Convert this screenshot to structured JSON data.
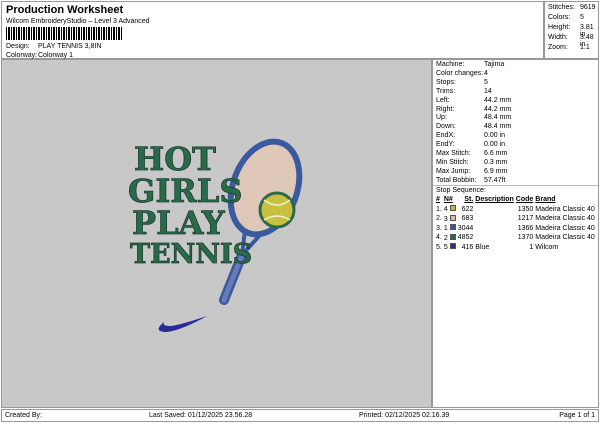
{
  "header": {
    "title": "Production Worksheet",
    "subtitle": "Wilcom EmbroideryStudio – Level 3 Advanced",
    "design_label": "Design:",
    "design_value": "PLAY TENNIS 3,8IN",
    "colorway_label": "Colorway:",
    "colorway_value": "Colorway 1"
  },
  "stats": [
    {
      "k": "Stitches:",
      "v": "9619"
    },
    {
      "k": "Colors:",
      "v": "5"
    },
    {
      "k": "Height:",
      "v": "3.81 in"
    },
    {
      "k": "Width:",
      "v": "3.48 in"
    },
    {
      "k": "Zoom:",
      "v": "1:1"
    }
  ],
  "design": {
    "lines": [
      "HOT",
      "GIRLS",
      "PLAY",
      "TENNIS"
    ]
  },
  "machine": [
    {
      "k": "Machine:",
      "v": "Tajima"
    },
    {
      "k": "Color changes:",
      "v": "4"
    },
    {
      "k": "Stops:",
      "v": "5"
    },
    {
      "k": "Trims:",
      "v": "14"
    },
    {
      "k": "Left:",
      "v": "44.2 mm"
    },
    {
      "k": "Right:",
      "v": "44.2 mm"
    },
    {
      "k": "Up:",
      "v": "48.4 mm"
    },
    {
      "k": "Down:",
      "v": "48.4 mm"
    },
    {
      "k": "EndX:",
      "v": "0.00 in"
    },
    {
      "k": "EndY:",
      "v": "0.00 in"
    },
    {
      "k": "Max Stitch:",
      "v": "6.6 mm"
    },
    {
      "k": "Min Stitch:",
      "v": "0.3 mm"
    },
    {
      "k": "Max Jump:",
      "v": "6.9 mm"
    },
    {
      "k": "Total Bobbin:",
      "v": "57.47ft"
    }
  ],
  "stop_sequence": {
    "title": "Stop Sequence:",
    "headers": [
      "#",
      "N#",
      "St.",
      "Description",
      "Code",
      "Brand"
    ],
    "rows": [
      {
        "n": "1.",
        "nn": "4",
        "color": "#c8b040",
        "st": "622",
        "desc": "",
        "code": "1350",
        "brand": "Madeira Classic 40"
      },
      {
        "n": "2.",
        "nn": "3",
        "color": "#e8b09c",
        "st": "683",
        "desc": "",
        "code": "1217",
        "brand": "Madeira Classic 40"
      },
      {
        "n": "3.",
        "nn": "1",
        "color": "#3a5aa0",
        "st": "3044",
        "desc": "",
        "code": "1366",
        "brand": "Madeira Classic 40"
      },
      {
        "n": "4.",
        "nn": "2",
        "color": "#2a6a4a",
        "st": "4852",
        "desc": "",
        "code": "1370",
        "brand": "Madeira Classic 40"
      },
      {
        "n": "5.",
        "nn": "5",
        "color": "#2a2a9a",
        "st": "416",
        "desc": "Blue",
        "code": "1",
        "brand": "Wilcom"
      }
    ]
  },
  "footer": {
    "created": "Created By:",
    "saved": "Last Saved: 01/12/2025 23.56.28",
    "printed": "Printed: 02/12/2025 02.16.39",
    "page": "Page 1 of 1"
  }
}
